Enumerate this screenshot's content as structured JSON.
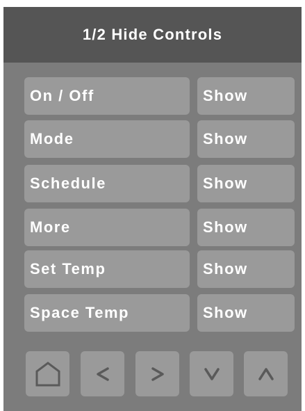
{
  "header": {
    "title": "1/2 Hide Controls"
  },
  "rows": [
    {
      "label": "On / Off",
      "action": "Show"
    },
    {
      "label": "Mode",
      "action": "Show"
    },
    {
      "label": "Schedule",
      "action": "Show"
    },
    {
      "label": "More",
      "action": "Show"
    },
    {
      "label": "Set Temp",
      "action": "Show"
    },
    {
      "label": "Space Temp",
      "action": "Show"
    }
  ],
  "nav": [
    {
      "icon": "home-icon"
    },
    {
      "icon": "chevron-left-icon"
    },
    {
      "icon": "chevron-right-icon"
    },
    {
      "icon": "chevron-down-icon"
    },
    {
      "icon": "chevron-up-icon"
    }
  ],
  "colors": {
    "panel": "#7c7c7c",
    "header": "#555555",
    "button": "#9a9a9a",
    "text": "#ffffff",
    "icon": "#5a5a5a"
  }
}
